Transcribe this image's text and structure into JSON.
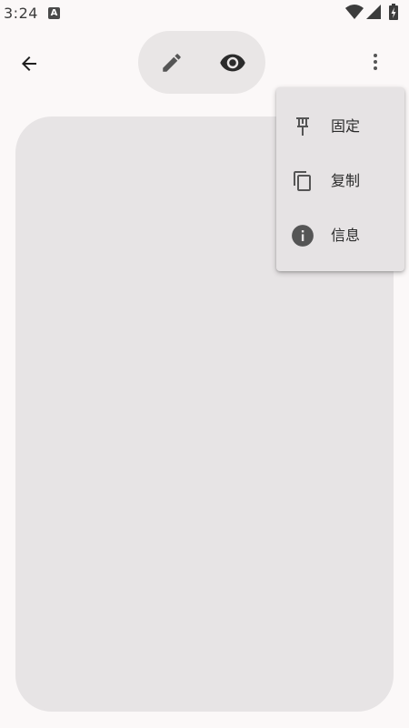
{
  "status_bar": {
    "time": "3:24",
    "notification_icon": "A"
  },
  "toolbar": {
    "back_icon": "arrow-back-icon",
    "edit_icon": "pencil-icon",
    "view_icon": "eye-icon",
    "more_icon": "more-vert-icon"
  },
  "menu": {
    "items": [
      {
        "label": "固定",
        "icon": "pin-icon"
      },
      {
        "label": "复制",
        "icon": "copy-icon"
      },
      {
        "label": "信息",
        "icon": "info-icon"
      }
    ]
  },
  "colors": {
    "background": "#fbf8f8",
    "toggle_background": "#e9e6e6",
    "card_background": "#e7e4e5",
    "menu_background": "#e6e3e4",
    "icon": "#555555"
  }
}
